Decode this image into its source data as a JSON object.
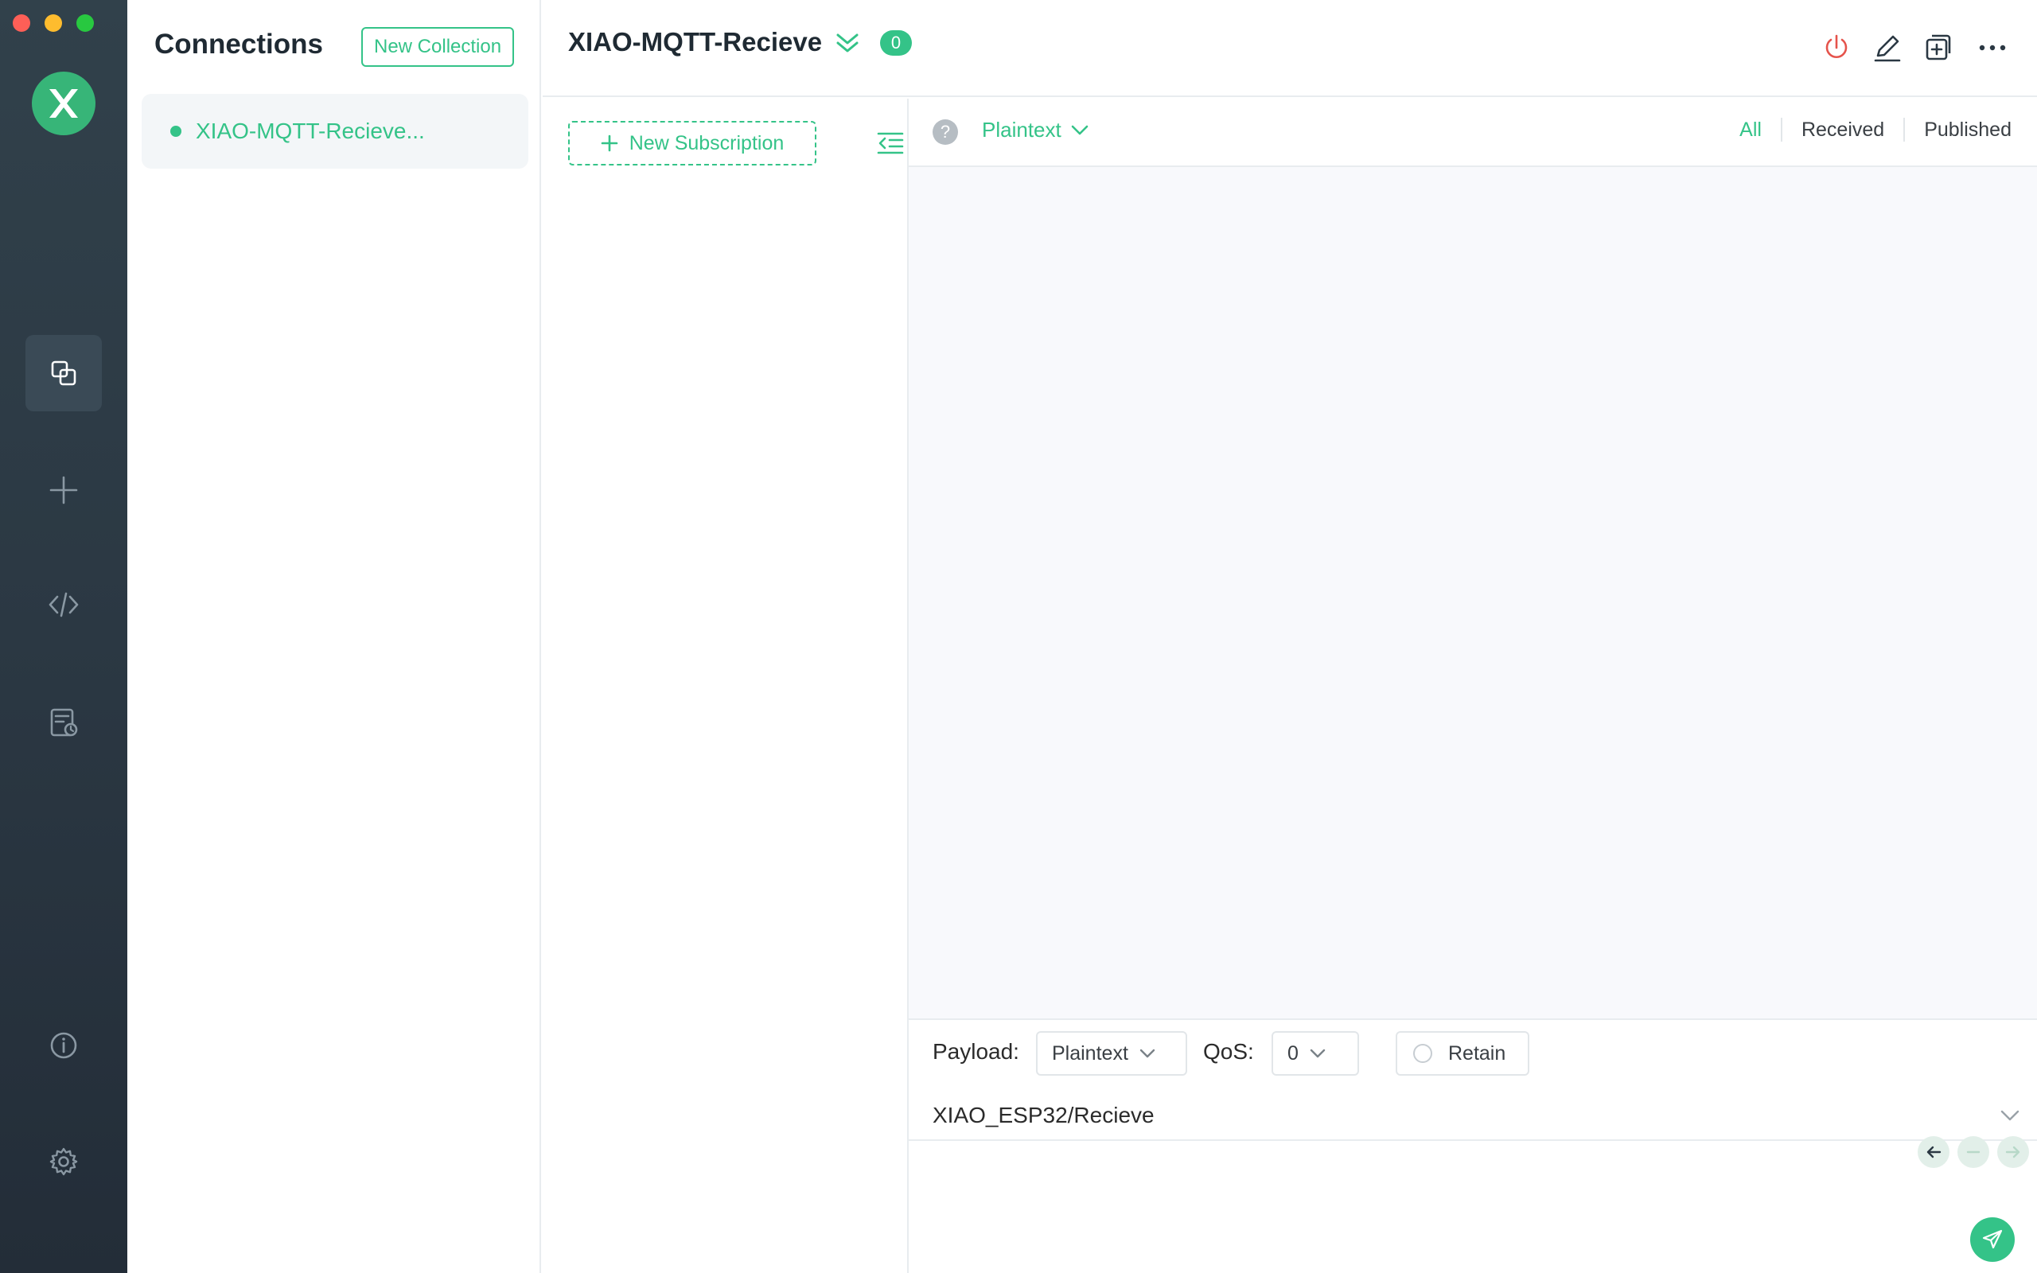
{
  "sidebar": {
    "title": "Connections",
    "new_collection_label": "New Collection",
    "connections": [
      {
        "name": "XIAO-MQTT-Recieve...",
        "status": "connected"
      }
    ],
    "nav_icons": [
      "connections-icon",
      "add-icon",
      "script-icon",
      "log-icon",
      "about-icon",
      "settings-icon"
    ]
  },
  "header": {
    "title": "XIAO-MQTT-Recieve",
    "unread_count": "0"
  },
  "subscriptions": {
    "new_subscription_label": "New Subscription"
  },
  "messages": {
    "format": "Plaintext",
    "filters": {
      "all": "All",
      "received": "Received",
      "published": "Published"
    },
    "active_filter": "All"
  },
  "publish": {
    "payload_label": "Payload:",
    "payload_format": "Plaintext",
    "qos_label": "QoS:",
    "qos_value": "0",
    "retain_label": "Retain",
    "topic": "XIAO_ESP32/Recieve"
  },
  "colors": {
    "accent": "#34c388",
    "nav_bg": "#2b3843",
    "disconnect": "#e5534b"
  }
}
